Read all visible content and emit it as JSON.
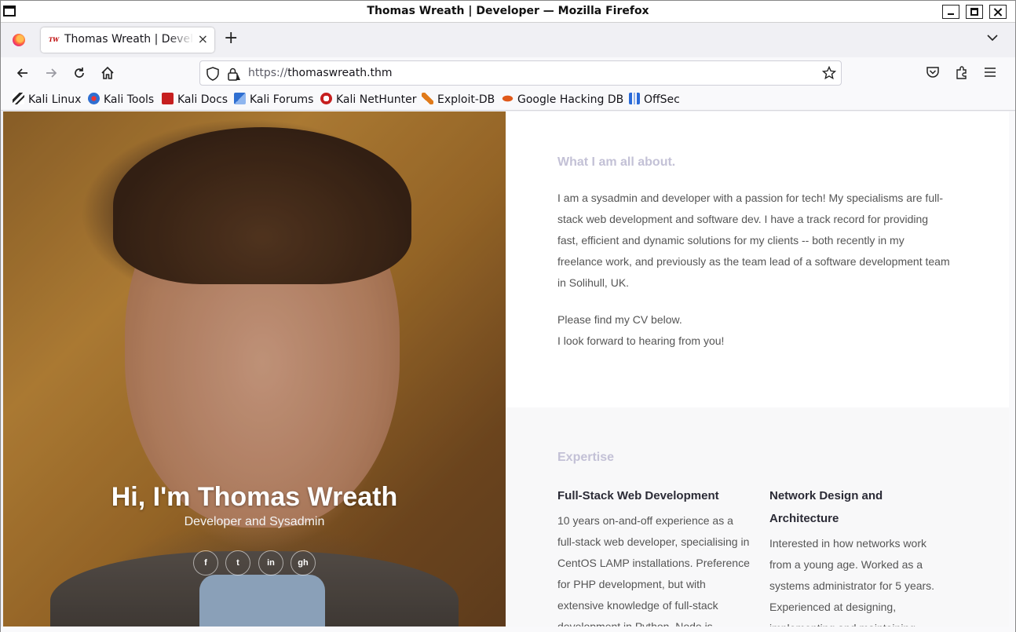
{
  "window": {
    "title": "Thomas Wreath | Developer — Mozilla Firefox"
  },
  "tabs": [
    {
      "title": "Thomas Wreath | Developer",
      "favicon_text": "TW",
      "active": true
    }
  ],
  "toolbar": {
    "new_tab_glyph": "+",
    "close_tab_glyph": "×",
    "url_scheme": "https://",
    "url_host": "thomaswreath.thm"
  },
  "bookmarks": [
    {
      "label": "Kali Linux",
      "icon": "kali-dragon-icon",
      "color": "#222222"
    },
    {
      "label": "Kali Tools",
      "icon": "kali-tools-icon",
      "color": "#2f6fd1"
    },
    {
      "label": "Kali Docs",
      "icon": "kali-docs-icon",
      "color": "#c61f1f"
    },
    {
      "label": "Kali Forums",
      "icon": "kali-forums-icon",
      "color": "#2f6fd1"
    },
    {
      "label": "Kali NetHunter",
      "icon": "nethunter-icon",
      "color": "#c61f1f"
    },
    {
      "label": "Exploit-DB",
      "icon": "exploit-db-icon",
      "color": "#e07a1a"
    },
    {
      "label": "Google Hacking DB",
      "icon": "ghdb-icon",
      "color": "#e0591a"
    },
    {
      "label": "OffSec",
      "icon": "offsec-icon",
      "color": "#2a6ad8"
    }
  ],
  "hero": {
    "title": "Hi, I'm Thomas Wreath",
    "subtitle": "Developer and Sysadmin",
    "social": [
      {
        "name": "facebook",
        "glyph": "f"
      },
      {
        "name": "twitter",
        "glyph": "t"
      },
      {
        "name": "linkedin",
        "glyph": "in"
      },
      {
        "name": "github",
        "glyph": "gh"
      }
    ]
  },
  "about": {
    "heading": "What I am all about.",
    "paragraph": "I am a sysadmin and developer with a passion for tech! My specialisms are full-stack web development and software dev. I have a track record for providing fast, efficient and dynamic solutions for my clients -- both recently in my freelance work, and previously as the team lead of a software development team in Solihull, UK.",
    "line1": "Please find my CV below.",
    "line2": "I look forward to hearing from you!"
  },
  "expertise": {
    "heading": "Expertise",
    "items": [
      {
        "title": "Full-Stack Web Development",
        "text": "10 years on-and-off experience as a full-stack web developer, specialising in CentOS LAMP installations. Preference for PHP development, but with extensive knowledge of full-stack development in Python, Node.js"
      },
      {
        "title": "Network Design and Architecture",
        "text": "Interested in how networks work from a young age. Worked as a systems administrator for 5 years. Experienced at designing, implementing and maintaining"
      }
    ]
  },
  "colors": {
    "heading_muted": "#c3c1d6",
    "body_text": "#555555",
    "expertise_bg": "#f8f8f9"
  }
}
